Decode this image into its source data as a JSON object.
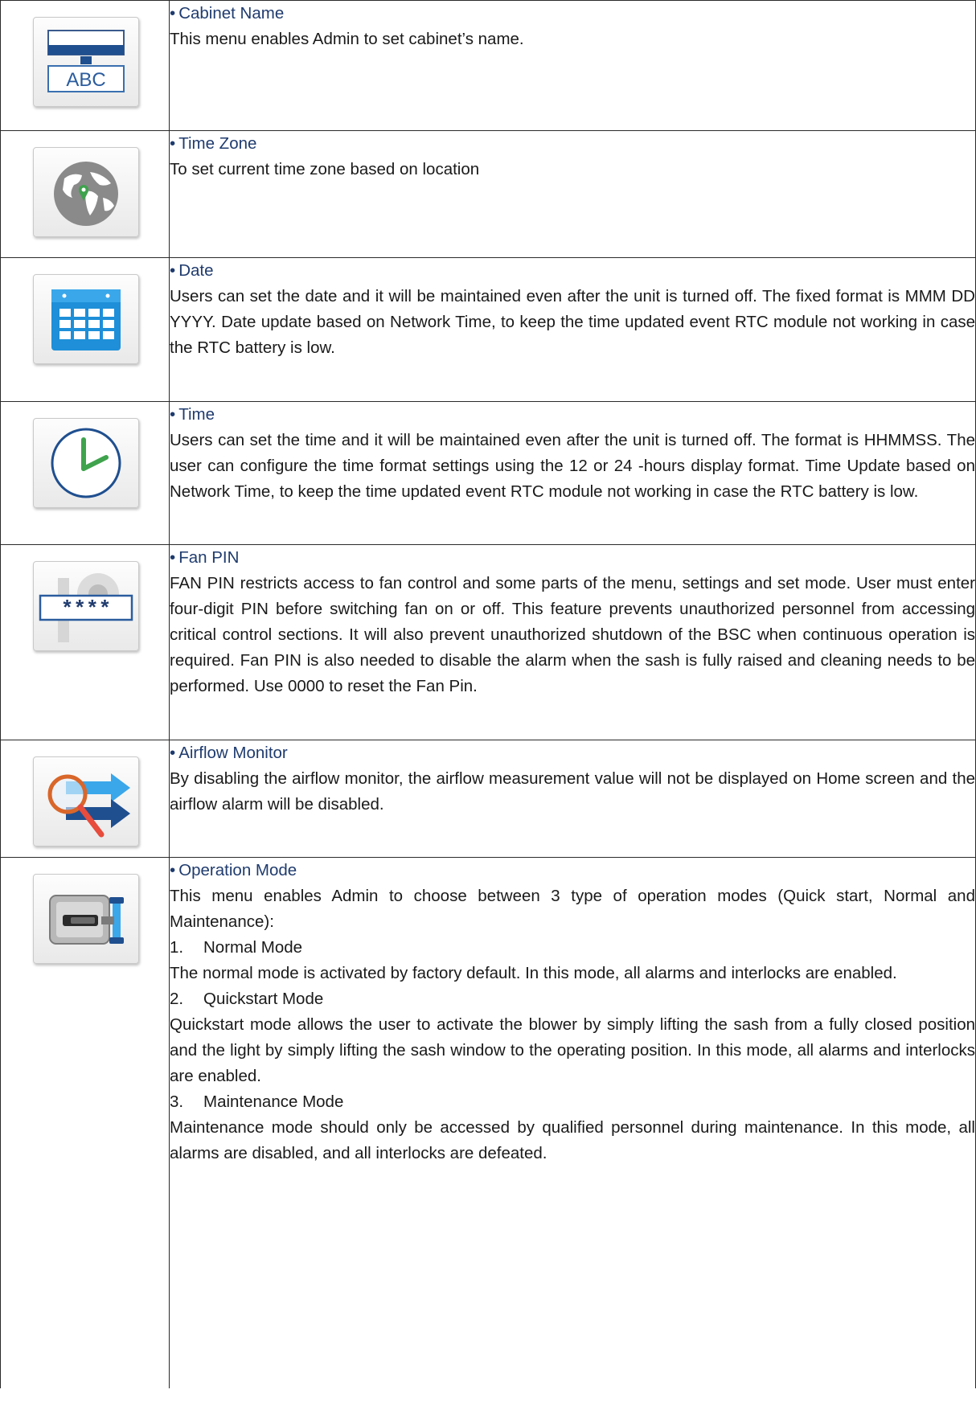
{
  "rows": [
    {
      "icon": "cabinet-name-icon",
      "icon_text": "ABC",
      "title": "Cabinet Name",
      "text": "This menu enables Admin to set cabinet’s name."
    },
    {
      "icon": "globe-icon",
      "title": "Time Zone",
      "text": "To set current time zone based on location"
    },
    {
      "icon": "calendar-icon",
      "title": "Date",
      "text": "Users can set the date and it will be maintained even after the unit is turned off. The fixed format is MMM DD YYYY. Date update based on Network Time, to keep the time updated event RTC module not working in case the RTC battery is low."
    },
    {
      "icon": "clock-icon",
      "title": "Time",
      "text": "Users can set the time and it will be maintained even after the unit is turned off. The format is HHMMSS. The user can configure the time format settings using the 12 or 24 -hours display format. Time Update based on Network Time, to keep the time updated event RTC module not working in case the RTC battery is low."
    },
    {
      "icon": "pin-icon",
      "icon_text": "****",
      "title": "Fan PIN",
      "text": "FAN PIN restricts access to fan control and some parts of the menu, settings and set mode. User must enter four-digit PIN before switching fan on or off. This feature prevents unauthorized personnel from accessing critical control sections. It will also prevent unauthorized shutdown of the BSC when continuous operation is required. Fan PIN is also needed to disable the alarm when the sash is fully raised and cleaning needs to be performed. Use 0000 to reset the Fan Pin."
    },
    {
      "icon": "airflow-monitor-icon",
      "title": "Airflow Monitor",
      "text": "By disabling the airflow monitor, the airflow measurement value will not be displayed on Home screen and the airflow alarm will   be disabled."
    },
    {
      "icon": "operation-mode-icon",
      "title": "Operation Mode",
      "text": "This menu enables Admin to choose between 3 type of operation modes (Quick start, Normal and Maintenance):",
      "modes": [
        {
          "num": "1.",
          "name": "Normal Mode",
          "desc": "The normal mode is activated by factory default. In this mode, all alarms and interlocks are enabled."
        },
        {
          "num": "2.",
          "name": "Quickstart Mode",
          "desc": "Quickstart mode allows the user to activate the blower by simply lifting the sash from a fully closed position and the light by simply lifting the sash window to the operating position. In this mode, all alarms and interlocks are enabled."
        },
        {
          "num": "3.",
          "name": "Maintenance Mode",
          "desc": "Maintenance mode should only be accessed by qualified personnel during maintenance. In this mode, all alarms are disabled, and all interlocks are defeated."
        }
      ]
    }
  ],
  "bullet": "•",
  "colors": {
    "heading": "#1f3b6e",
    "border": "#2a2a2a"
  }
}
